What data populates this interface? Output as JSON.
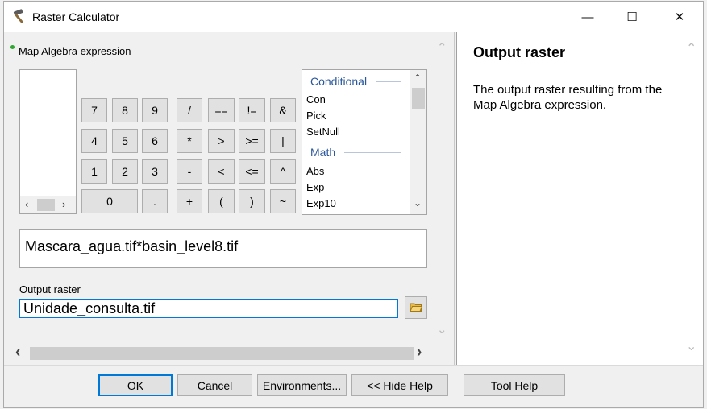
{
  "window": {
    "title": "Raster Calculator",
    "controls": {
      "minimize": "—",
      "maximize": "☐",
      "close": "✕"
    }
  },
  "map_algebra": {
    "label": "Map Algebra expression",
    "keypad": {
      "row1": [
        "7",
        "8",
        "9",
        "/",
        "==",
        "!=",
        "&"
      ],
      "row2": [
        "4",
        "5",
        "6",
        "*",
        ">",
        ">=",
        "|"
      ],
      "row3": [
        "1",
        "2",
        "3",
        "-",
        "<",
        "<=",
        "^"
      ],
      "row4": [
        "0",
        ".",
        "+",
        "(",
        ")",
        "~"
      ]
    },
    "functions": {
      "group1": "Conditional",
      "group1_items": [
        "Con",
        "Pick",
        "SetNull"
      ],
      "group2": "Math",
      "group2_items": [
        "Abs",
        "Exp",
        "Exp10"
      ]
    },
    "expression": "Mascara_agua.tif*basin_level8.tif"
  },
  "output": {
    "label": "Output raster",
    "value": "Unidade_consulta.tif"
  },
  "help": {
    "title": "Output raster",
    "body": "The output raster resulting from the Map Algebra expression."
  },
  "buttons": {
    "ok": "OK",
    "cancel": "Cancel",
    "environments": "Environments...",
    "hide_help": "<< Hide Help",
    "tool_help": "Tool Help"
  },
  "icons": {
    "title": "hammer-icon",
    "folder": "open-folder-icon"
  }
}
